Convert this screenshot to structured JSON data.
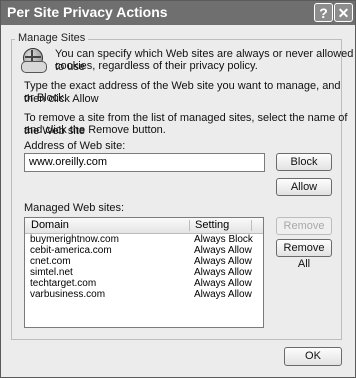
{
  "window": {
    "title": "Per Site Privacy Actions",
    "help_glyph": "?",
    "close_glyph": "✕"
  },
  "group": {
    "legend": "Manage Sites"
  },
  "intro": {
    "line1": "You can specify which Web sites are always or never allowed to use",
    "line2": "cookies, regardless of their privacy policy."
  },
  "instructions": {
    "line1": "Type the exact address of the Web site you want to manage, and then click Allow",
    "line2": "or Block.",
    "line3": "To remove a site from the list of managed sites, select the name of the Web site",
    "line4": "and click the Remove button."
  },
  "address": {
    "label": "Address of Web site:",
    "value": "www.oreilly.com"
  },
  "buttons": {
    "block": "Block",
    "allow": "Allow",
    "remove": "Remove",
    "remove_all": "Remove All",
    "ok": "OK"
  },
  "managed": {
    "label": "Managed Web sites:",
    "columns": {
      "domain": "Domain",
      "setting": "Setting"
    },
    "rows": [
      {
        "domain": "buymerightnow.com",
        "setting": "Always Block"
      },
      {
        "domain": "cebit-america.com",
        "setting": "Always Allow"
      },
      {
        "domain": "cnet.com",
        "setting": "Always Allow"
      },
      {
        "domain": "simtel.net",
        "setting": "Always Allow"
      },
      {
        "domain": "techtarget.com",
        "setting": "Always Allow"
      },
      {
        "domain": "varbusiness.com",
        "setting": "Always Allow"
      }
    ]
  }
}
